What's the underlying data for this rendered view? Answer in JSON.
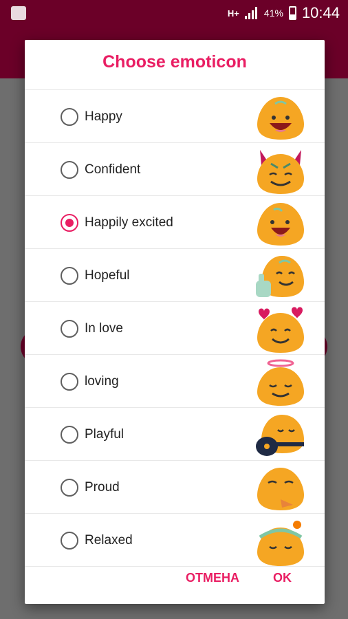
{
  "status_bar": {
    "network": "H+",
    "battery": "41%",
    "time": "10:44"
  },
  "dialog": {
    "title": "Choose emoticon",
    "cancel_label": "ОТМЕНА",
    "ok_label": "OK"
  },
  "emoticons": [
    {
      "label": "Happy",
      "checked": false
    },
    {
      "label": "Confident",
      "checked": false
    },
    {
      "label": "Happily excited",
      "checked": true
    },
    {
      "label": "Hopeful",
      "checked": false
    },
    {
      "label": "In love",
      "checked": false
    },
    {
      "label": "loving",
      "checked": false
    },
    {
      "label": "Playful",
      "checked": false
    },
    {
      "label": "Proud",
      "checked": false
    },
    {
      "label": "Relaxed",
      "checked": false
    }
  ],
  "colors": {
    "accent": "#e91e63",
    "app_bar": "#6b0028",
    "emoji_fill": "#f5a623"
  }
}
